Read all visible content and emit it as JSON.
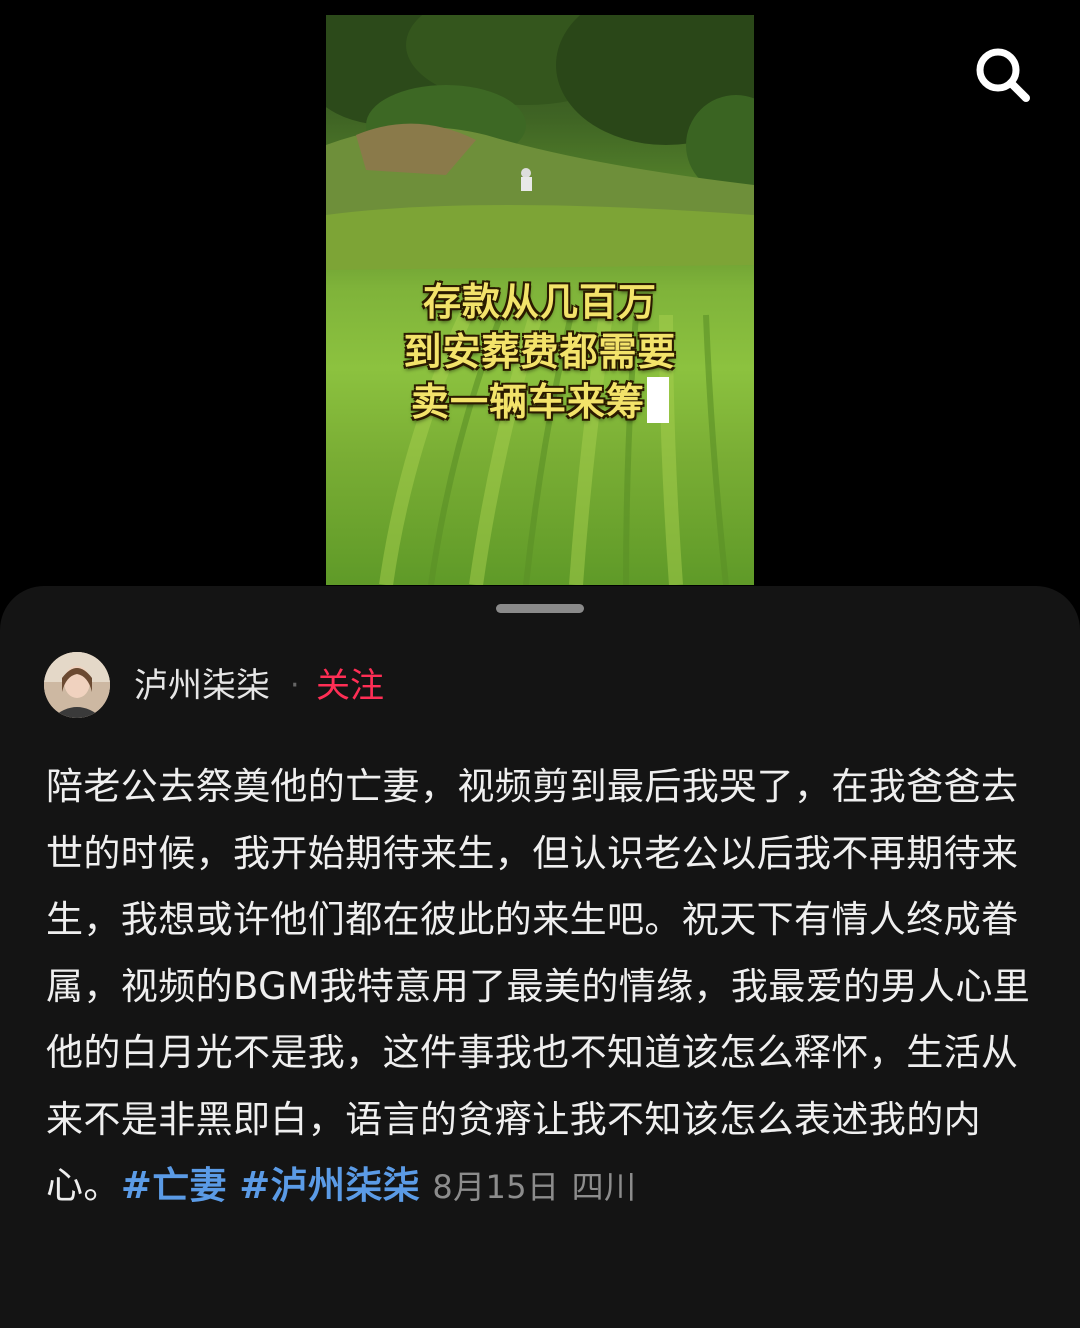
{
  "video": {
    "caption_lines": [
      "存款从几百万",
      "到安葬费都需要",
      "卖一辆车来筹"
    ]
  },
  "toolbar": {
    "search_icon": "search-icon"
  },
  "author": {
    "name": "泸州柒柒",
    "separator": "·",
    "follow_label": "关注"
  },
  "post": {
    "text": "陪老公去祭奠他的亡妻，视频剪到最后我哭了，在我爸爸去世的时候，我开始期待来生，但认识老公以后我不再期待来生，我想或许他们都在彼此的来生吧。祝天下有情人终成眷属，视频的BGM我特意用了最美的情缘，我最爱的男人心里他的白月光不是我，这件事我也不知道该怎么释怀，生活从来不是非黑即白，语言的贫瘠让我不知该怎么表述我的内心。",
    "hashtags": [
      "#亡妻",
      "#泸州柒柒"
    ],
    "date": "8月15日",
    "location": "四川"
  },
  "colors": {
    "sheet_bg": "#141414",
    "follow": "#ff2e55",
    "hashtag": "#5b9be6",
    "meta": "#8c8c8c"
  }
}
